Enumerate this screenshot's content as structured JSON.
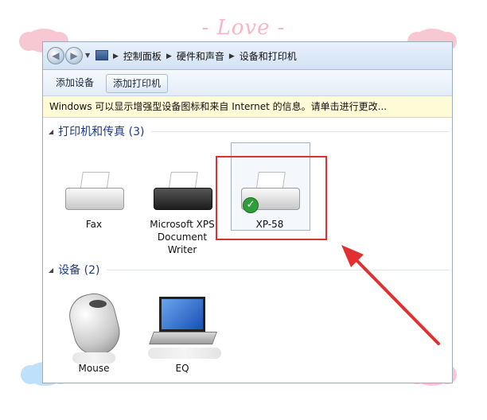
{
  "decor": {
    "title": "- Love -"
  },
  "window": {
    "breadcrumb": [
      "控制面板",
      "硬件和声音",
      "设备和打印机"
    ],
    "toolbar": {
      "add_device": "添加设备",
      "add_printer": "添加打印机"
    },
    "infobar": "Windows 可以显示增强型设备图标和来自 Internet 的信息。请单击进行更改...",
    "groups": {
      "printers": {
        "header": "打印机和传真 (3)",
        "items": [
          {
            "label": "Fax",
            "icon": "fax-icon"
          },
          {
            "label": "Microsoft XPS Document Writer",
            "icon": "printer-icon"
          },
          {
            "label": "XP-58",
            "icon": "printer-default-icon",
            "default": true
          }
        ]
      },
      "devices": {
        "header": "设备 (2)",
        "items": [
          {
            "label": "Mouse",
            "icon": "mouse-icon"
          },
          {
            "label": "EQ",
            "icon": "laptop-icon"
          }
        ]
      }
    }
  },
  "colors": {
    "highlight_box": "#e0302f",
    "arrow": "#e0302f",
    "group_header": "#1e3a8a"
  }
}
